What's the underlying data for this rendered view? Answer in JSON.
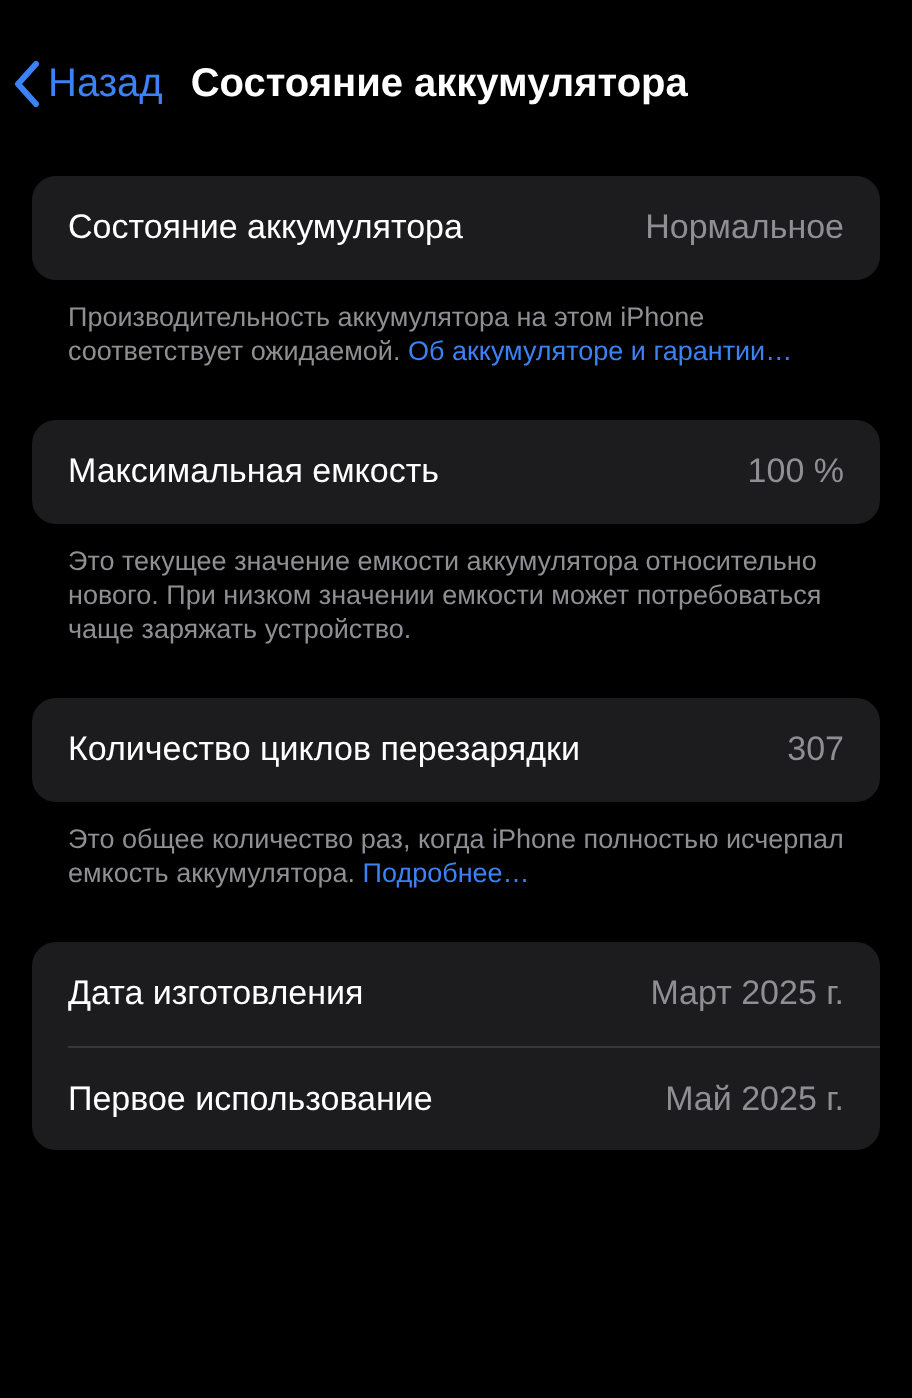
{
  "nav": {
    "back": "Назад",
    "title": "Состояние аккумулятора"
  },
  "sections": [
    {
      "rows": [
        {
          "label": "Состояние аккумулятора",
          "value": "Нормальное"
        }
      ],
      "footer": {
        "text": "Производительность аккумулятора на этом iPhone соответствует ожидаемой.",
        "link": "Об аккумуляторе и гарантии…"
      }
    },
    {
      "rows": [
        {
          "label": "Максимальная емкость",
          "value": "100 %"
        }
      ],
      "footer": {
        "text": "Это текущее значение емкости аккумулятора относительно нового. При низком значении емкости может потребоваться чаще заряжать устройство."
      }
    },
    {
      "rows": [
        {
          "label": "Количество циклов перезарядки",
          "value": "307"
        }
      ],
      "footer": {
        "text": "Это общее количество раз, когда iPhone полностью исчерпал емкость аккумулятора.",
        "link": "Подробнее…"
      }
    },
    {
      "rows": [
        {
          "label": "Дата изготовления",
          "value": "Март 2025 г."
        },
        {
          "label": "Первое использование",
          "value": "Май 2025 г."
        }
      ]
    }
  ]
}
